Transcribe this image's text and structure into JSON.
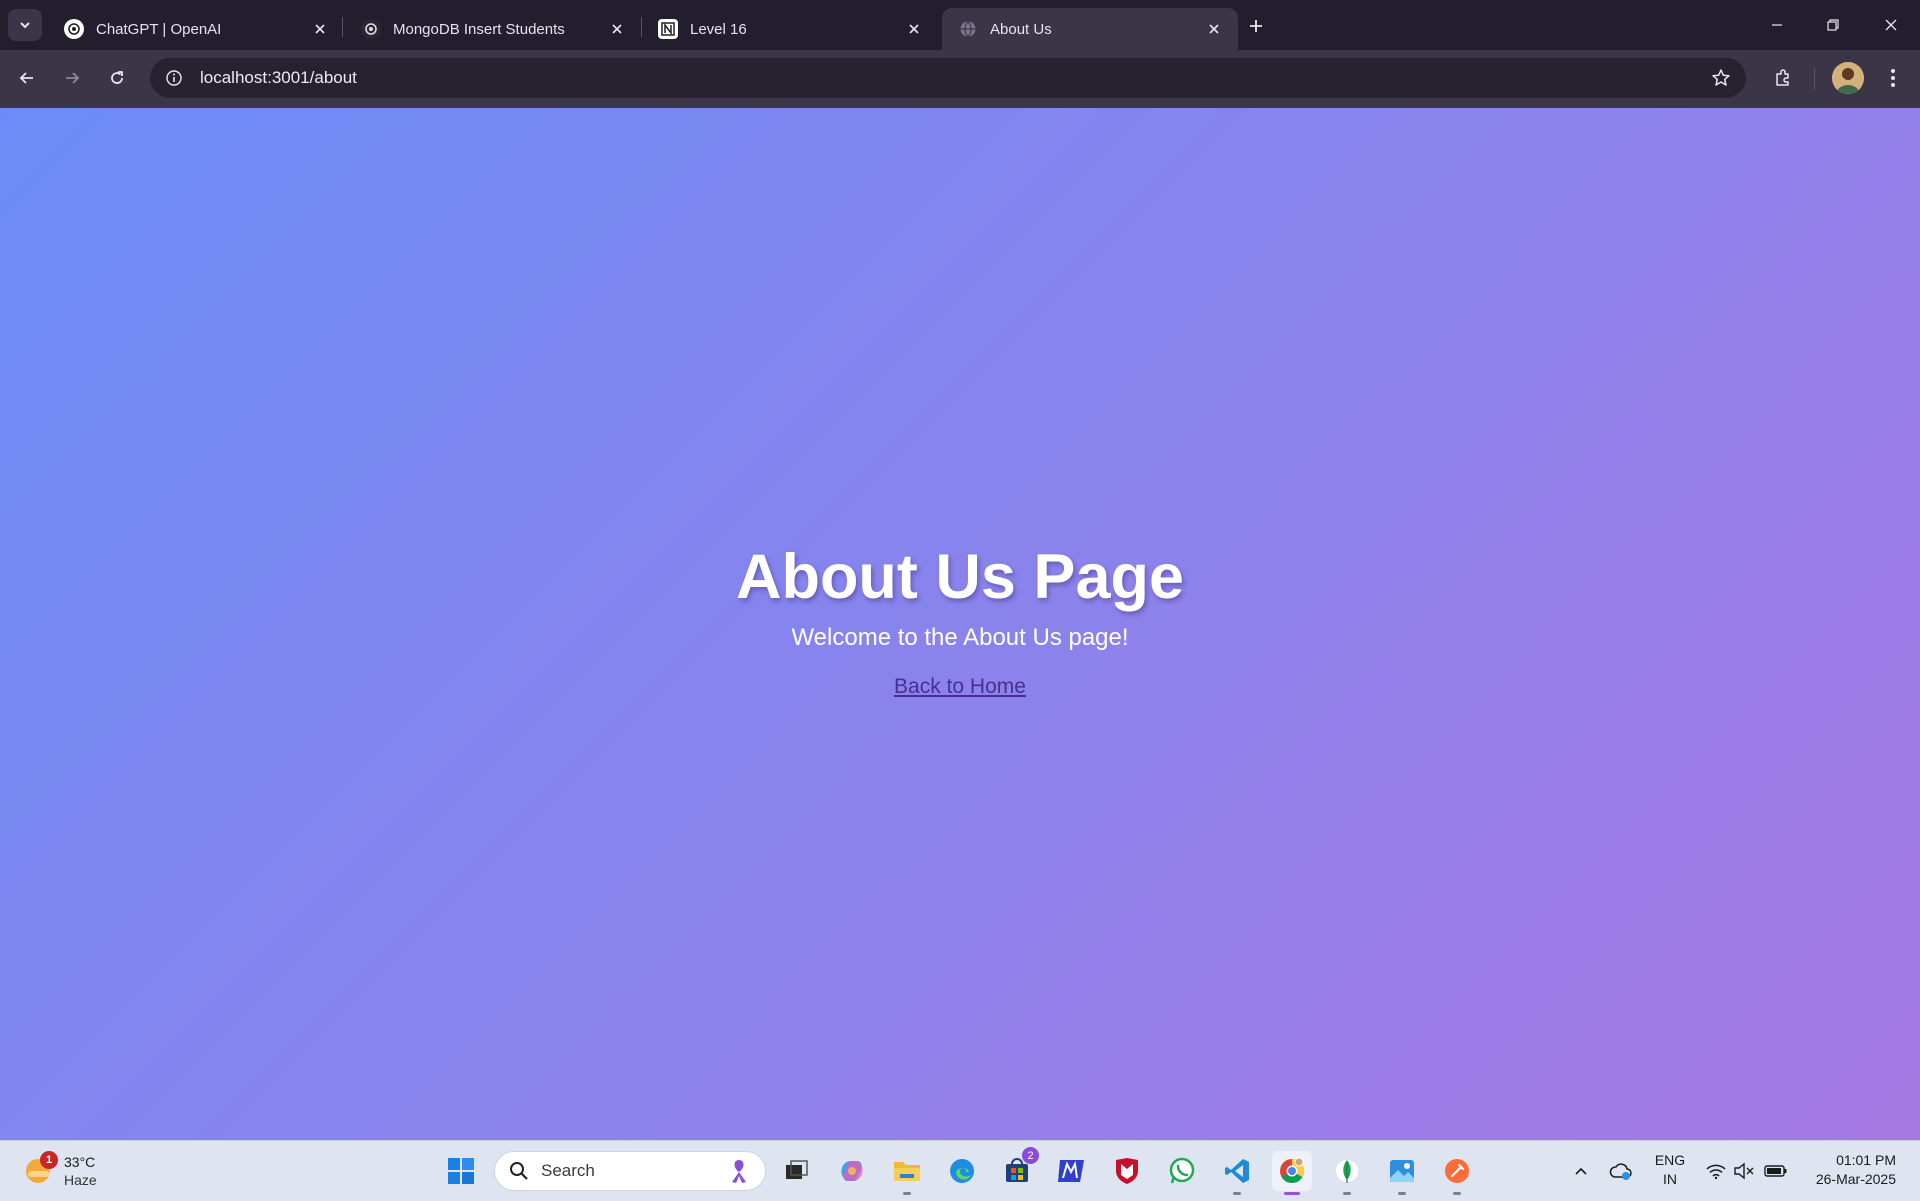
{
  "browser": {
    "tabs": [
      {
        "title": "ChatGPT | OpenAI",
        "active": false
      },
      {
        "title": "MongoDB Insert Students",
        "active": false
      },
      {
        "title": "Level 16",
        "active": false
      },
      {
        "title": "About Us",
        "active": true
      }
    ],
    "url": "localhost:3001/about"
  },
  "page": {
    "title": "About Us Page",
    "welcome": "Welcome to the About Us page!",
    "back_link": "Back to Home",
    "gradient": [
      "#6b8cf8",
      "#a678e2"
    ]
  },
  "taskbar": {
    "weather": {
      "temp": "33°C",
      "condition": "Haze",
      "badge": "1"
    },
    "search_placeholder": "Search",
    "store_badge": "2",
    "language": {
      "line1": "ENG",
      "line2": "IN"
    },
    "clock": {
      "time": "01:01 PM",
      "date": "26-Mar-2025"
    }
  }
}
